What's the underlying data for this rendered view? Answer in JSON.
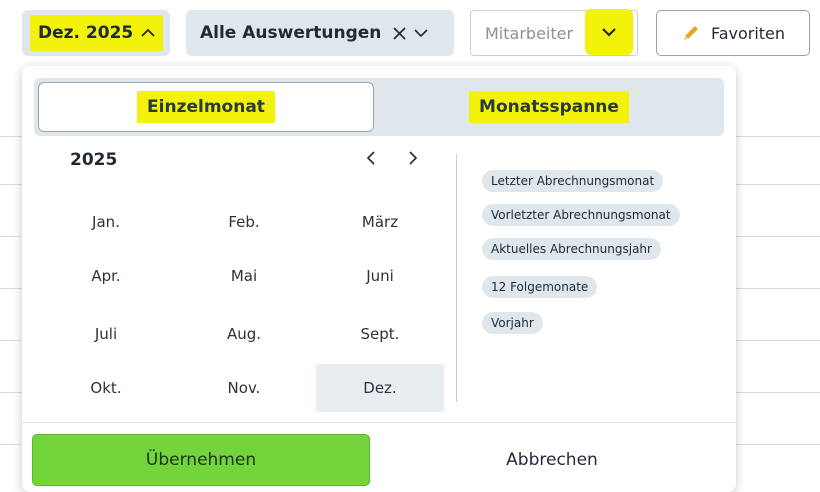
{
  "toolbar": {
    "period_label": "Dez. 2025",
    "period_icon": "chevron-up-icon",
    "report_label": "Alle Auswertungen",
    "report_clear_icon": "close-icon",
    "employee_placeholder": "Mitarbeiter",
    "favorites_label": "Favoriten",
    "favorites_icon": "pencil-icon"
  },
  "picker": {
    "tabs": [
      {
        "label": "Einzelmonat",
        "active": true
      },
      {
        "label": "Monatsspanne",
        "active": false
      }
    ],
    "year": "2025",
    "prev_symbol": "‹",
    "next_symbol": "›",
    "months": [
      "Jan.",
      "Feb.",
      "März",
      "Apr.",
      "Mai",
      "Juni",
      "Juli",
      "Aug.",
      "Sept.",
      "Okt.",
      "Nov.",
      "Dez."
    ],
    "selected_month": "Dez.",
    "presets": [
      "Letzter Abrechnungsmonat",
      "Vorletzter Abrechnungsmonat",
      "Aktuelles Abrechnungsjahr",
      "12 Folgemonate",
      "Vorjahr"
    ],
    "apply_label": "Übernehmen",
    "cancel_label": "Abbrechen"
  },
  "colors": {
    "highlight": "#f2f20a",
    "chip_bg": "#dfe6ec",
    "apply_green": "#74d43c"
  }
}
